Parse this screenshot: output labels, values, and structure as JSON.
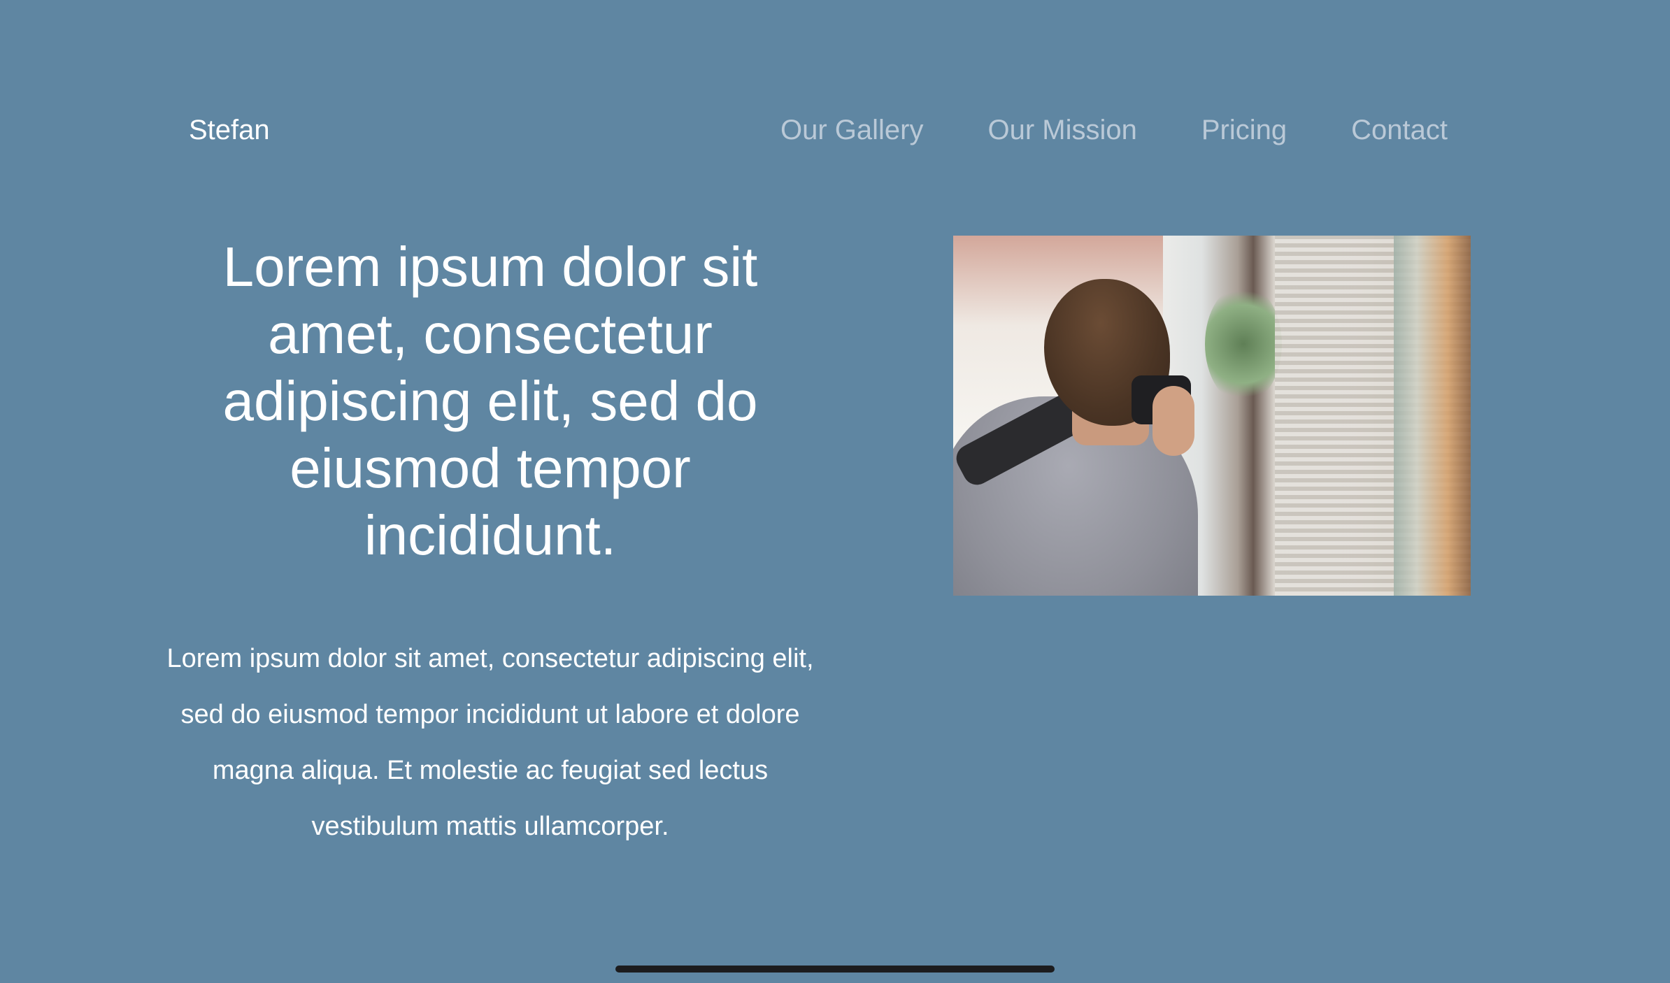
{
  "header": {
    "brand": "Stefan",
    "nav": [
      {
        "label": "Our Gallery"
      },
      {
        "label": "Our Mission"
      },
      {
        "label": "Pricing"
      },
      {
        "label": "Contact"
      }
    ]
  },
  "hero": {
    "headline": "Lorem ipsum dolor sit amet, consectetur adipiscing elit, sed do eiusmod tempor incididunt.",
    "body": "Lorem ipsum dolor sit amet, consectetur adipiscing elit, sed do eiusmod tempor incididunt ut labore et dolore magna aliqua. Et molestie ac feugiat sed lectus vestibulum mattis ullamcorper."
  },
  "colors": {
    "background": "#5f86a2",
    "nav_text": "#bac9d7",
    "text": "#ffffff",
    "home_indicator": "#1c1c1e"
  }
}
